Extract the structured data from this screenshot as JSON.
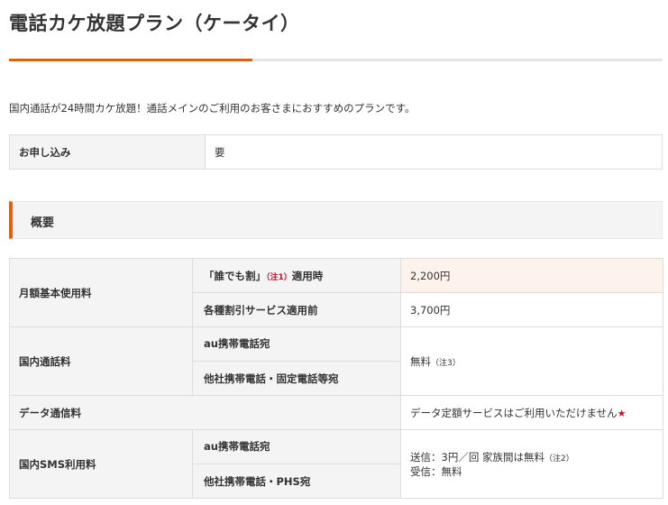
{
  "title": "電話カケ放題プラン（ケータイ）",
  "intro": "国内通話が24時間カケ放題！通話メインのご利用のお客さまにおすすめのプランです。",
  "application": {
    "label": "お申し込み",
    "value": "要"
  },
  "section": {
    "heading": "概要"
  },
  "overview": {
    "monthly": {
      "label": "月額基本使用料",
      "discount_pre": "「誰でも割」",
      "discount_note": "（注1）",
      "discount_post": "適用時",
      "discount_price": "2,200円",
      "before_label": "各種割引サービス適用前",
      "before_price": "3,700円"
    },
    "domestic_call": {
      "label": "国内通話料",
      "au_label": "au携帯電話宛",
      "other_label": "他社携帯電話・固定電話等宛",
      "value": "無料",
      "value_note": "（注3）"
    },
    "data": {
      "label": "データ通信料",
      "value": "データ定額サービスはご利用いただけません",
      "star": "★"
    },
    "sms": {
      "label": "国内SMS利用料",
      "au_label": "au携帯電話宛",
      "other_label": "他社携帯電話・PHS宛",
      "send": "送信：3円／回 家族間は無料",
      "send_note": "（注2）",
      "receive": "受信：無料"
    }
  }
}
